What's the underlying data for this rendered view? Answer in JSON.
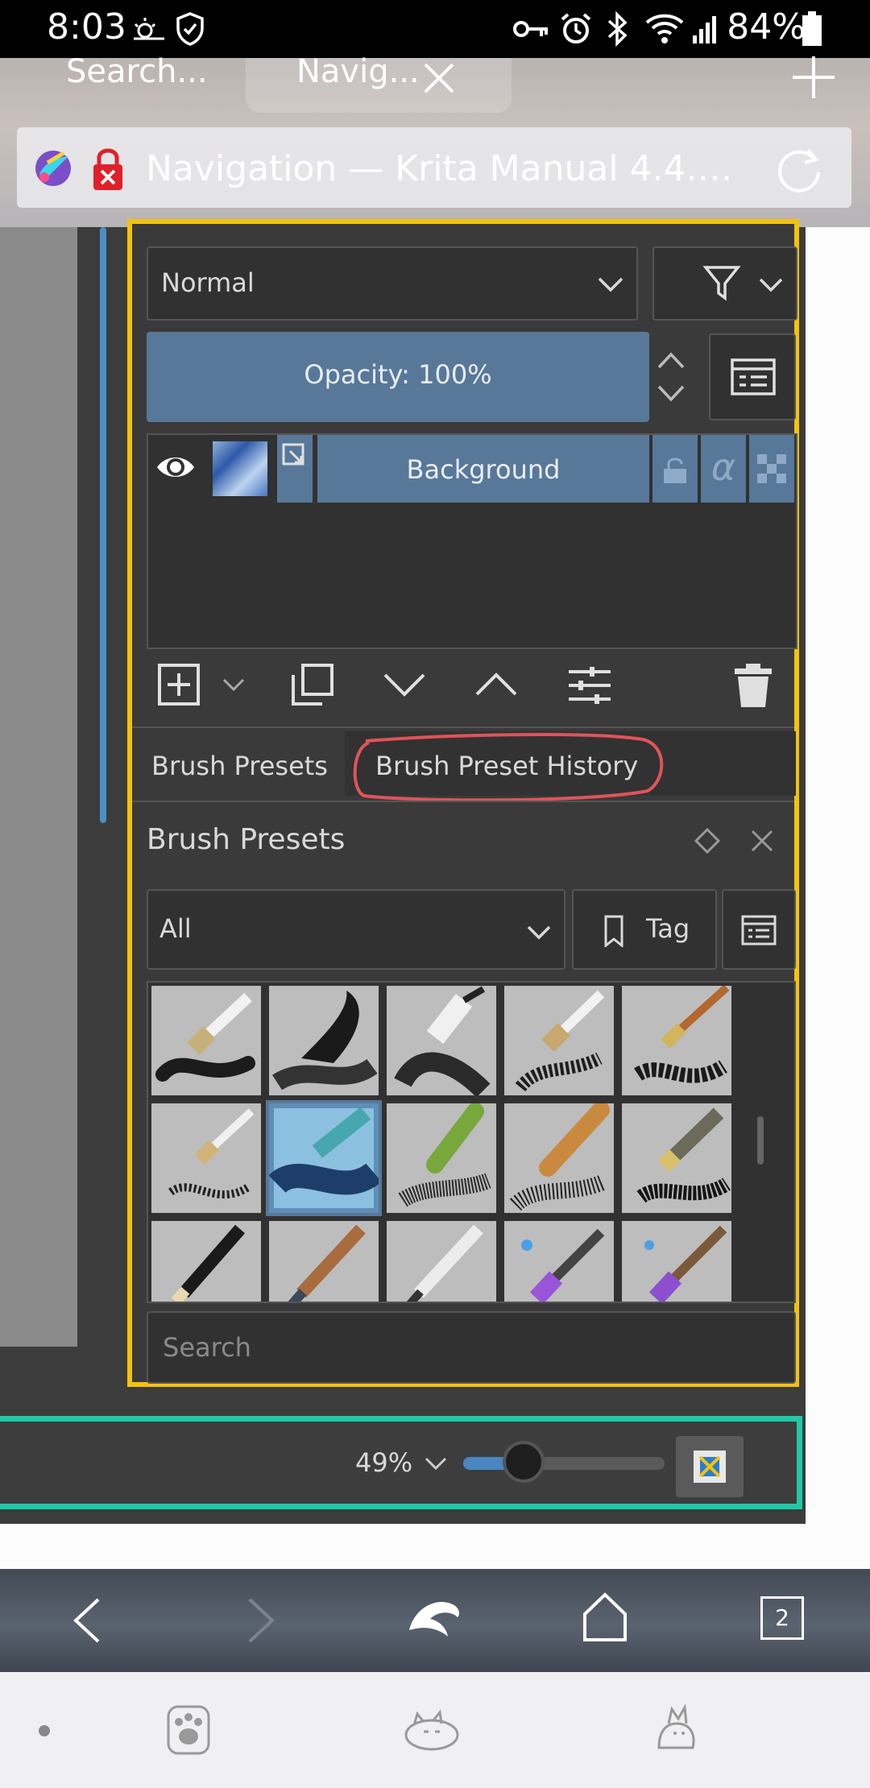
{
  "status_bar": {
    "time": "8:03",
    "battery": "84%"
  },
  "browser": {
    "tabs": [
      {
        "label": "Search..."
      },
      {
        "label": "Navig..."
      }
    ],
    "address": {
      "title": "Navigation — Krita Manual 4.4.0 ..."
    },
    "tab_count": "2"
  },
  "krita": {
    "blend_mode": "Normal",
    "opacity_label": "Opacity:  100%",
    "layer_name": "Background",
    "alpha_glyph": "α",
    "docker_tabs": [
      {
        "label": "Brush Presets"
      },
      {
        "label": "Brush Preset History"
      }
    ],
    "presets_title": "Brush Presets",
    "filter_value": "All",
    "tag_label": "Tag",
    "search_placeholder": "Search",
    "zoom_label": "49%",
    "zoom_fraction": 0.3
  },
  "colors": {
    "highlight_yellow": "#f4c20d",
    "highlight_teal": "#20c9a6",
    "annotation_red": "#e0545a",
    "krita_selection": "#58789a"
  }
}
